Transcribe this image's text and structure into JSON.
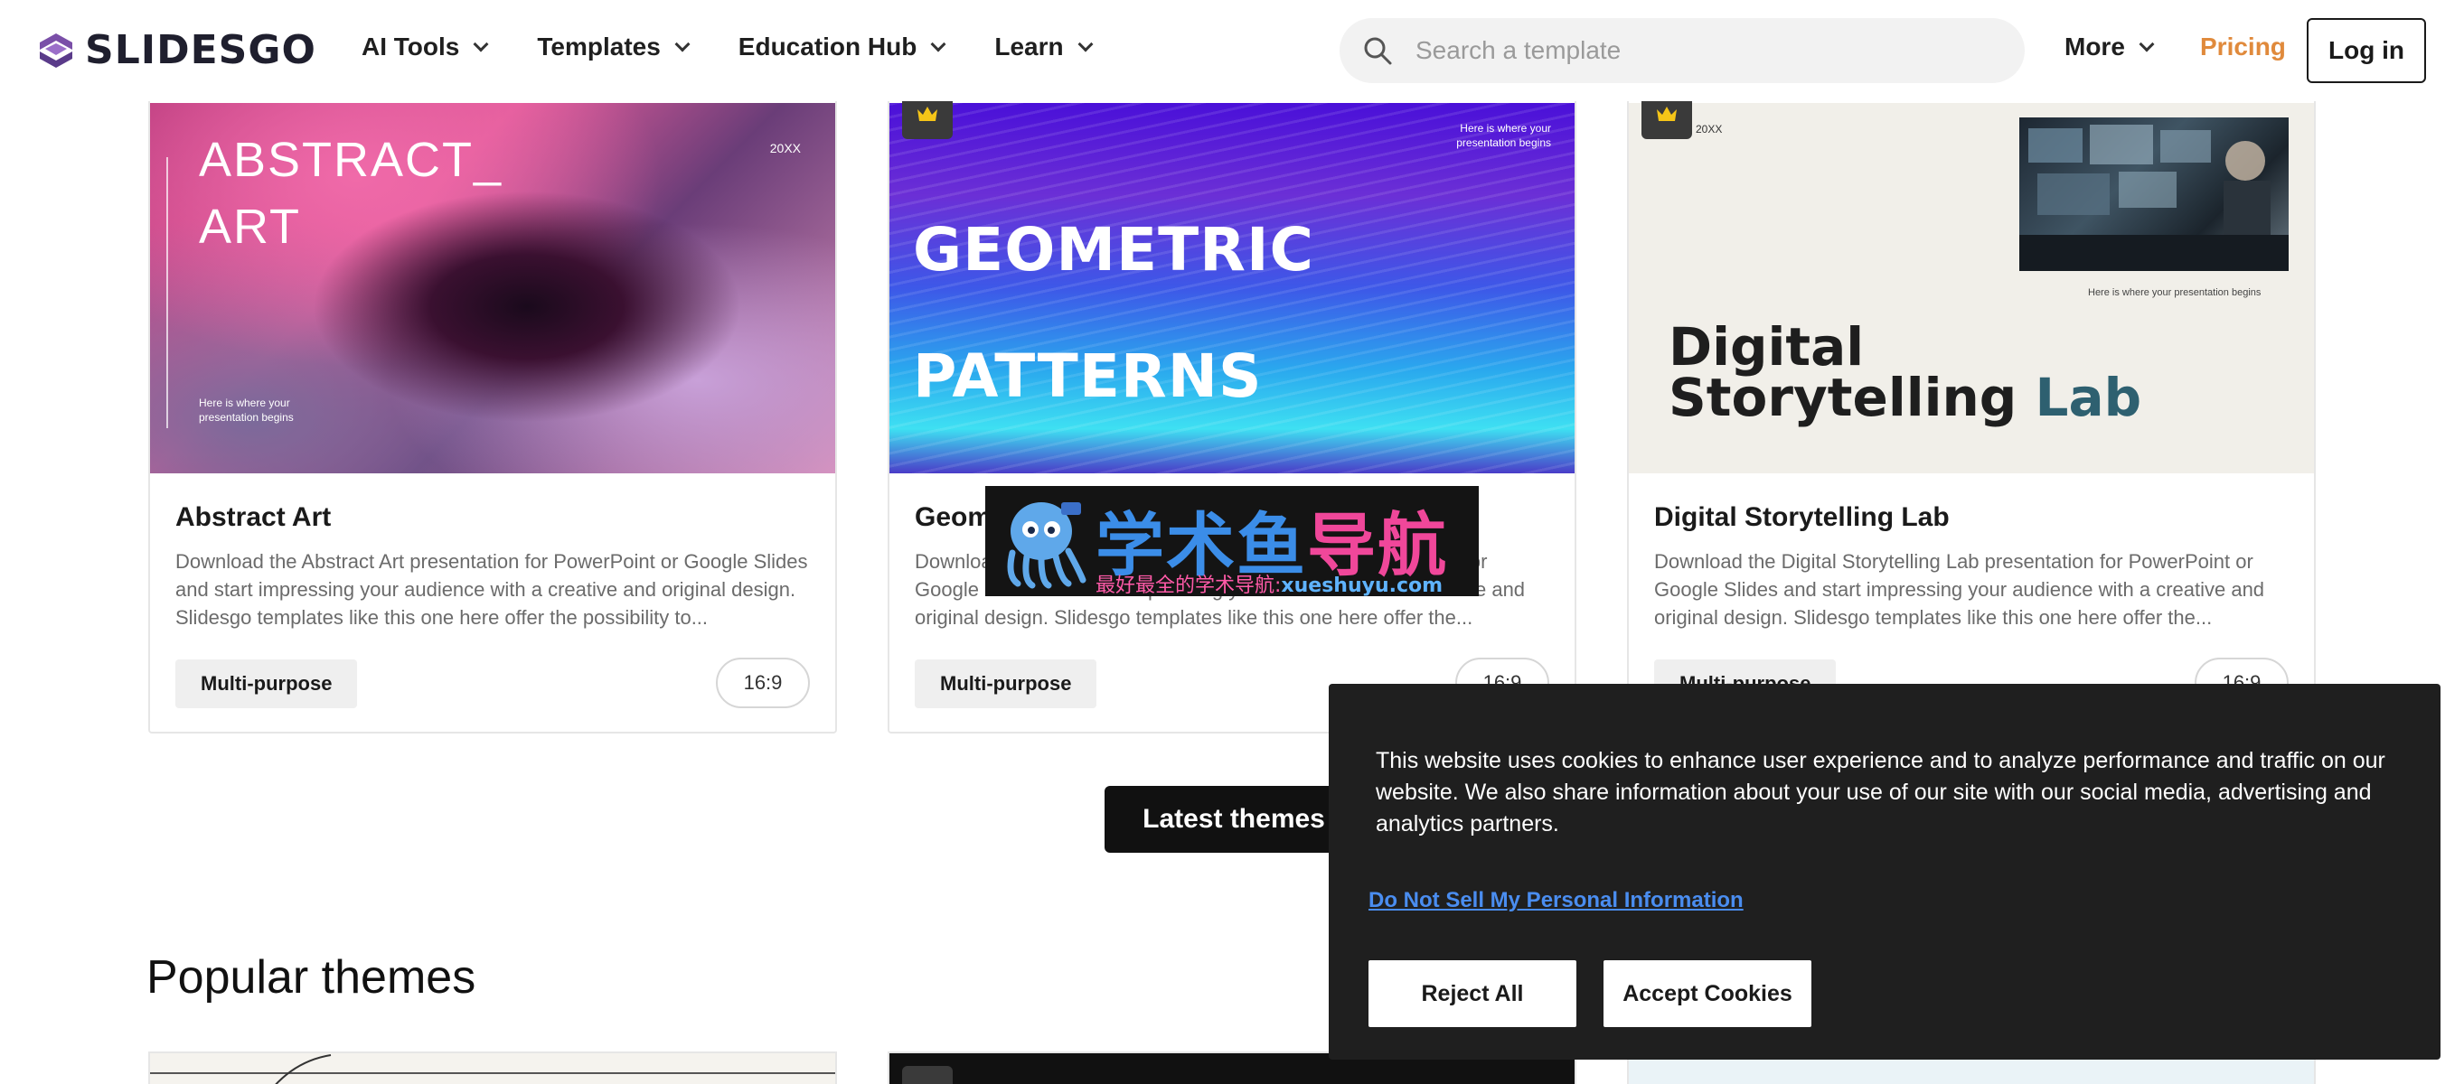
{
  "header": {
    "logo_text": "SLIDESGO",
    "nav": [
      {
        "label": "AI Tools"
      },
      {
        "label": "Templates"
      },
      {
        "label": "Education Hub"
      },
      {
        "label": "Learn"
      }
    ],
    "search_placeholder": "Search a template",
    "more_label": "More",
    "pricing_label": "Pricing",
    "login_label": "Log in"
  },
  "colors": {
    "accent_pricing": "#e08a3c",
    "link_blue": "#4a8df0",
    "cookie_bg": "#1f1f1f"
  },
  "cards": [
    {
      "title": "Abstract Art",
      "description": "Download the Abstract Art presentation for PowerPoint or Google Slides and start impressing your audience with a creative and original design. Slidesgo templates like this one here offer the possibility to...",
      "tag": "Multi-purpose",
      "ratio": "16:9",
      "premium": false,
      "thumb": {
        "title_line1": "ABSTRACT_",
        "title_line2": "ART",
        "year": "20XX",
        "subtitle_line1": "Here is where your",
        "subtitle_line2": "presentation begins"
      }
    },
    {
      "title": "Geometric Patterns",
      "description": "Download the Geometric Patterns presentation for PowerPoint or Google Slides and start impressing your audience with a creative and original design. Slidesgo templates like this one here offer the...",
      "tag": "Multi-purpose",
      "ratio": "16:9",
      "premium": true,
      "thumb": {
        "title_line1": "GEOMETRIC",
        "title_line2": "PATTERNS",
        "subtitle_line1": "Here is where your",
        "subtitle_line2": "presentation begins"
      }
    },
    {
      "title": "Digital Storytelling Lab",
      "description": "Download the Digital Storytelling Lab presentation for PowerPoint or Google Slides and start impressing your audience with a creative and original design. Slidesgo templates like this one here offer the...",
      "tag": "Multi-purpose",
      "ratio": "16:9",
      "premium": true,
      "thumb": {
        "year": "20XX",
        "subtitle": "Here is where your presentation begins",
        "title_line1": "Digital",
        "title_line2": "Storytelling",
        "title_accent": "Lab"
      }
    }
  ],
  "latest_button": "Latest themes",
  "popular_heading": "Popular themes",
  "watermark": {
    "big_blue": "学术鱼",
    "big_pink": "导航",
    "small_pink": "最好最全的学术导航:",
    "small_blue": "xueshuyu.com"
  },
  "cookie": {
    "text": "This website uses cookies to enhance user experience and to analyze performance and traffic on our website. We also share information about your use of our site with our social media, advertising and analytics partners.",
    "link": "Do Not Sell My Personal Information",
    "reject": "Reject All",
    "accept": "Accept Cookies"
  }
}
